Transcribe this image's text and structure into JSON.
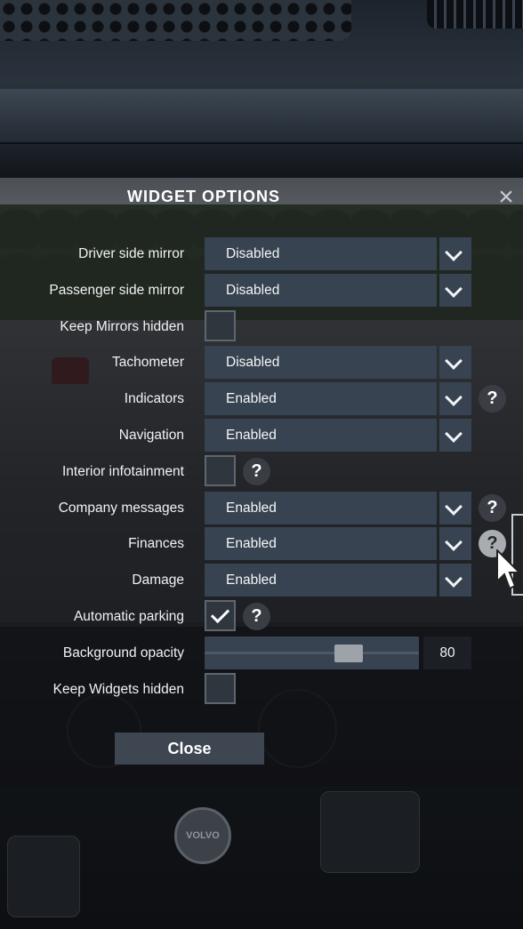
{
  "dialog": {
    "title": "WIDGET OPTIONS",
    "close_icon": "close-x-icon"
  },
  "options": [
    {
      "label": "Driver side mirror",
      "type": "select",
      "value": "Disabled",
      "help": false
    },
    {
      "label": "Passenger side mirror",
      "type": "select",
      "value": "Disabled",
      "help": false
    },
    {
      "label": "Keep Mirrors hidden",
      "type": "checkbox",
      "checked": false,
      "help": false
    },
    {
      "label": "Tachometer",
      "type": "select",
      "value": "Disabled",
      "help": false
    },
    {
      "label": "Indicators",
      "type": "select",
      "value": "Enabled",
      "help": true
    },
    {
      "label": "Navigation",
      "type": "select",
      "value": "Enabled",
      "help": false
    },
    {
      "label": "Interior infotainment",
      "type": "checkbox",
      "checked": false,
      "help": true
    },
    {
      "label": "Company messages",
      "type": "select",
      "value": "Enabled",
      "help": true
    },
    {
      "label": "Finances",
      "type": "select",
      "value": "Enabled",
      "help": true,
      "help_hovered": true
    },
    {
      "label": "Damage",
      "type": "select",
      "value": "Enabled",
      "help": false
    },
    {
      "label": "Automatic parking",
      "type": "checkbox",
      "checked": true,
      "help": true
    },
    {
      "label": "Background opacity",
      "type": "slider",
      "value": "80",
      "fraction": 0.7
    },
    {
      "label": "Keep Widgets hidden",
      "type": "checkbox",
      "checked": false,
      "help": false
    }
  ],
  "help_glyph": "?",
  "footer": {
    "close_label": "Close"
  },
  "background": {
    "dash_logo_text": "VOLVO"
  },
  "colors": {
    "field_bg": "#374350",
    "button_bg": "#3d4651",
    "text": "#f1f2f4"
  }
}
